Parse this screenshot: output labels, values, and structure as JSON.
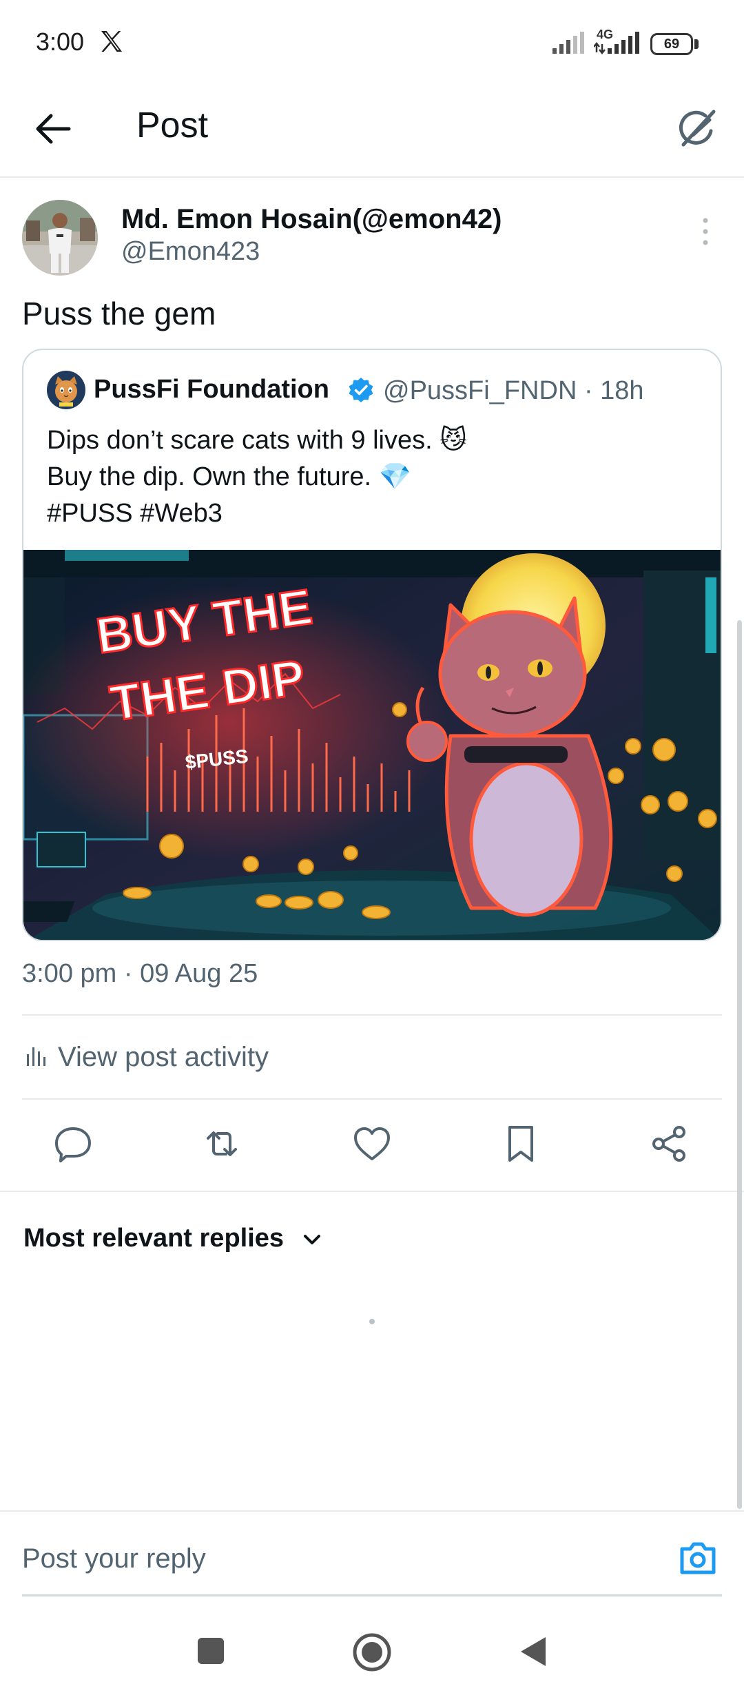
{
  "status_bar": {
    "time": "3:00",
    "network": "4G",
    "battery": "69"
  },
  "header": {
    "title": "Post"
  },
  "post": {
    "author_name": "Md. Emon Hosain(@emon42)",
    "author_handle": "@Emon423",
    "text": "Puss the gem",
    "timestamp": "3:00 pm · 09 Aug 25"
  },
  "quote": {
    "name": "PussFi Foundation",
    "handle_time": "@PussFi_FNDN · 18h",
    "lines": [
      "Dips don’t scare cats with 9 lives. 😼",
      " Buy the dip. Own the future. 💎",
      "#PUSS #Web3"
    ],
    "image_text": {
      "line1": "BUY THE",
      "line2": "THE DIP",
      "ticker": "$PUSS"
    }
  },
  "activity": {
    "label": "View post activity"
  },
  "replies": {
    "sort_label": "Most relevant replies"
  },
  "compose": {
    "placeholder": "Post your reply"
  },
  "colors": {
    "accent": "#1d9bf0",
    "text": "#0f1419",
    "secondary": "#536471",
    "divider": "#e7e9ea"
  },
  "icons": [
    "x-logo-icon",
    "signal-icon",
    "battery-icon",
    "back-arrow-icon",
    "grok-icon",
    "more-vertical-icon",
    "verified-badge-icon",
    "bar-chart-icon",
    "reply-icon",
    "repost-icon",
    "like-icon",
    "bookmark-icon",
    "share-icon",
    "chevron-down-icon",
    "camera-icon",
    "nav-recents-icon",
    "nav-home-icon",
    "nav-back-icon"
  ]
}
